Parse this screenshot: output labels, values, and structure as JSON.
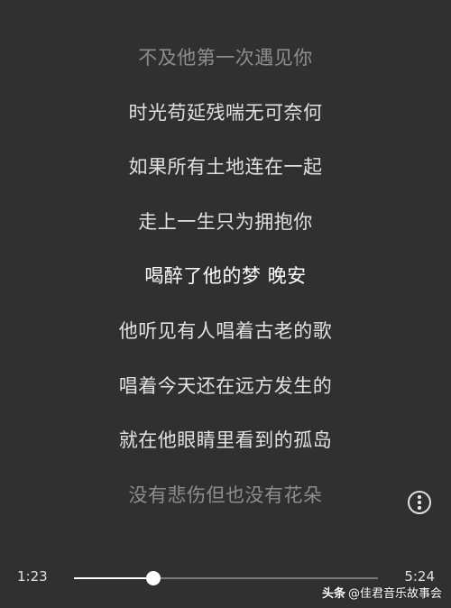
{
  "lyrics": [
    {
      "text": "不及他第一次遇见你",
      "state": "dim"
    },
    {
      "text": "时光苟延残喘无可奈何",
      "state": "normal"
    },
    {
      "text": "如果所有土地连在一起",
      "state": "normal"
    },
    {
      "text": "走上一生只为拥抱你",
      "state": "normal"
    },
    {
      "text": "喝醉了他的梦  晚安",
      "state": "active"
    },
    {
      "text": "他听见有人唱着古老的歌",
      "state": "normal"
    },
    {
      "text": "唱着今天还在远方发生的",
      "state": "normal"
    },
    {
      "text": "就在他眼睛里看到的孤岛",
      "state": "normal"
    },
    {
      "text": "没有悲伤但也没有花朵",
      "state": "dim"
    }
  ],
  "player": {
    "current_time": "1:23",
    "total_time": "5:24",
    "progress": 0.26
  },
  "more_button": {
    "icon": "more-vertical-icon"
  },
  "watermark": {
    "brand": "头条",
    "account": "@佳君音乐故事会"
  },
  "colors": {
    "background": "#303030",
    "text": "#ffffff"
  }
}
